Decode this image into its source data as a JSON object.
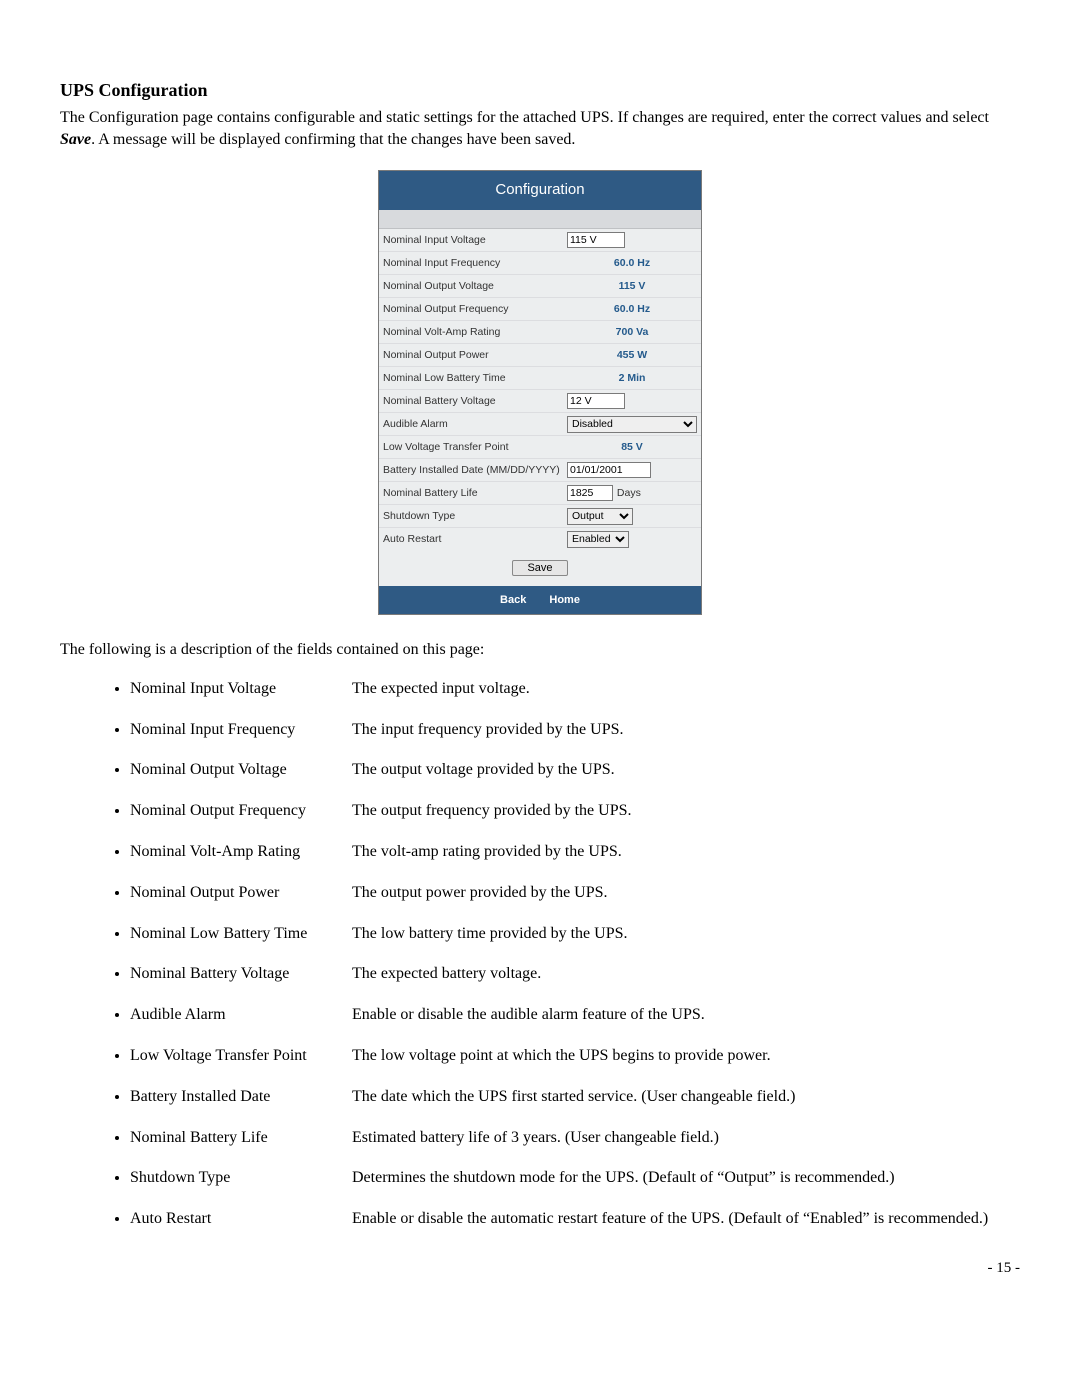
{
  "heading": "UPS Configuration",
  "intro_part1": "The Configuration page contains configurable and static settings for the attached UPS.  If changes are required, enter the correct values and select ",
  "intro_save_word": "Save",
  "intro_part2": ".  A message will be displayed confirming that the changes have been saved.",
  "panel": {
    "title": "Configuration",
    "rows": {
      "nom_in_v": {
        "label": "Nominal Input Voltage",
        "value": "115 V",
        "type": "input",
        "width": "small60"
      },
      "nom_in_f": {
        "label": "Nominal Input Frequency",
        "value": "60.0 Hz",
        "type": "static"
      },
      "nom_out_v": {
        "label": "Nominal Output Voltage",
        "value": "115 V",
        "type": "static"
      },
      "nom_out_f": {
        "label": "Nominal Output Frequency",
        "value": "60.0 Hz",
        "type": "static"
      },
      "nom_va": {
        "label": "Nominal Volt-Amp Rating",
        "value": "700 Va",
        "type": "static"
      },
      "nom_out_p": {
        "label": "Nominal Output Power",
        "value": "455 W",
        "type": "static"
      },
      "nom_lowbat_t": {
        "label": "Nominal Low Battery Time",
        "value": "2 Min",
        "type": "static"
      },
      "nom_bat_v": {
        "label": "Nominal Battery Voltage",
        "value": "12 V",
        "type": "input",
        "width": "small60"
      },
      "aud_alarm": {
        "label": "Audible Alarm",
        "value": "Disabled",
        "type": "select",
        "width": "wfull"
      },
      "low_v_xfer": {
        "label": "Low Voltage Transfer Point",
        "value": "85 V",
        "type": "static"
      },
      "bat_date": {
        "label": "Battery Installed Date (MM/DD/YYYY)",
        "value": "01/01/2001",
        "type": "input",
        "width": "small90"
      },
      "nom_bat_life": {
        "label": "Nominal Battery Life",
        "value": "1825",
        "unit": "Days",
        "type": "input-unit",
        "width": "small48"
      },
      "shutdown": {
        "label": "Shutdown Type",
        "value": "Output",
        "type": "select",
        "width": "wmed"
      },
      "auto_restart": {
        "label": "Auto Restart",
        "value": "Enabled",
        "type": "select",
        "width": "wsm"
      }
    },
    "save_label": "Save",
    "footer": {
      "back": "Back",
      "home": "Home"
    }
  },
  "desc_intro": "The following is a description of the fields contained on this page:",
  "fields": [
    {
      "term": "Nominal Input Voltage",
      "desc": "The expected input voltage."
    },
    {
      "term": "Nominal Input Frequency",
      "desc": "The input frequency provided by the UPS."
    },
    {
      "term": "Nominal Output Voltage",
      "desc": "The output voltage provided by the UPS."
    },
    {
      "term": "Nominal Output Frequency",
      "desc": "The output frequency provided by the UPS."
    },
    {
      "term": "Nominal Volt-Amp Rating",
      "desc": "The volt-amp rating provided by the UPS."
    },
    {
      "term": "Nominal Output Power",
      "desc": "The output power provided by the UPS."
    },
    {
      "term": "Nominal Low Battery Time",
      "desc": "The low battery time provided by the UPS."
    },
    {
      "term": "Nominal Battery Voltage",
      "desc": "The expected battery voltage."
    },
    {
      "term": "Audible Alarm",
      "desc": "Enable or disable the audible alarm feature of the UPS."
    },
    {
      "term": "Low Voltage Transfer Point",
      "desc": "The low voltage point at which the UPS begins to provide power."
    },
    {
      "term": "Battery Installed Date",
      "desc": "The date which the UPS first started service. (User changeable field.)"
    },
    {
      "term": "Nominal Battery Life",
      "desc": "Estimated battery life of 3 years. (User changeable field.)"
    },
    {
      "term": "Shutdown Type",
      "desc": "Determines the shutdown mode for the UPS. (Default of  “Output” is recommended.)"
    },
    {
      "term": "Auto Restart",
      "desc": "Enable or disable the automatic restart feature of the UPS. (Default of “Enabled” is recommended.)"
    }
  ],
  "page_number": "- 15 -"
}
